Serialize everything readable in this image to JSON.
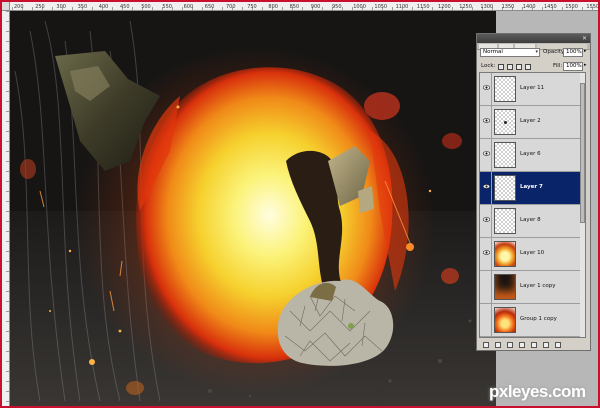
{
  "ruler": {
    "top_labels": [
      "200",
      "250",
      "300",
      "350",
      "400",
      "450",
      "500",
      "550",
      "600",
      "650",
      "700",
      "750",
      "800",
      "850",
      "900",
      "950",
      "1000",
      "1050",
      "1100",
      "1150",
      "1200",
      "1250",
      "1300",
      "1350",
      "1400",
      "1450",
      "1500",
      "1550"
    ]
  },
  "layers_panel": {
    "blend_mode": "Normal",
    "opacity_label": "Opacity:",
    "opacity_value": "100%",
    "lock_label": "Lock:",
    "fill_label": "Fill:",
    "fill_value": "100%",
    "layers": [
      {
        "name": "Layer 11",
        "visible": true,
        "selected": false,
        "thumb": "transparent"
      },
      {
        "name": "Layer 2",
        "visible": true,
        "selected": false,
        "thumb": "transparent-dot"
      },
      {
        "name": "Layer 6",
        "visible": true,
        "selected": false,
        "thumb": "transparent"
      },
      {
        "name": "Layer 7",
        "visible": true,
        "selected": true,
        "thumb": "transparent"
      },
      {
        "name": "Layer 8",
        "visible": true,
        "selected": false,
        "thumb": "transparent"
      },
      {
        "name": "Layer 10",
        "visible": true,
        "selected": false,
        "thumb": "fire"
      },
      {
        "name": "Layer 1 copy",
        "visible": false,
        "selected": false,
        "thumb": "dark-fire"
      },
      {
        "name": "Group 1 copy",
        "visible": false,
        "selected": false,
        "thumb": "flame"
      }
    ]
  },
  "watermark": "pxleyes.com",
  "colors": {
    "selection": "#0a246a",
    "frame": "#c8102e",
    "fire_core": "#fff36b",
    "fire_outer": "#e8420f"
  }
}
